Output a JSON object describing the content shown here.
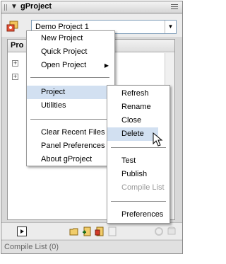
{
  "panel": {
    "title": "gProject",
    "project_select_value": "Demo Project 1",
    "tree_header": "Pro",
    "status_text": "Compile List (0)"
  },
  "main_menu": {
    "items": [
      {
        "label": "New Project",
        "enabled": true
      },
      {
        "label": "Quick Project",
        "enabled": true
      },
      {
        "label": "Open Project",
        "enabled": true,
        "submenu": true
      },
      {
        "label": "Project",
        "enabled": true,
        "active": true
      },
      {
        "label": "Utilities",
        "enabled": true
      },
      {
        "label": "Clear Recent Files",
        "enabled": true
      },
      {
        "label": "Panel Preferences",
        "enabled": true
      },
      {
        "label": "About gProject",
        "enabled": true
      }
    ],
    "submenu_arrow": "▶"
  },
  "project_submenu": {
    "items": [
      {
        "label": "Refresh",
        "enabled": true
      },
      {
        "label": "Rename",
        "enabled": true
      },
      {
        "label": "Close",
        "enabled": true
      },
      {
        "label": "Delete",
        "enabled": true,
        "active": true
      },
      {
        "label": "Test",
        "enabled": true
      },
      {
        "label": "Publish",
        "enabled": true
      },
      {
        "label": "Compile List",
        "enabled": false
      },
      {
        "label": "Preferences",
        "enabled": true
      }
    ]
  },
  "icons": {
    "title_collapse": "▼",
    "select_arrow": "▼",
    "expander": "+"
  },
  "colors": {
    "menu_highlight": "#d2e0f1",
    "disabled_text": "#9a9a9a"
  }
}
